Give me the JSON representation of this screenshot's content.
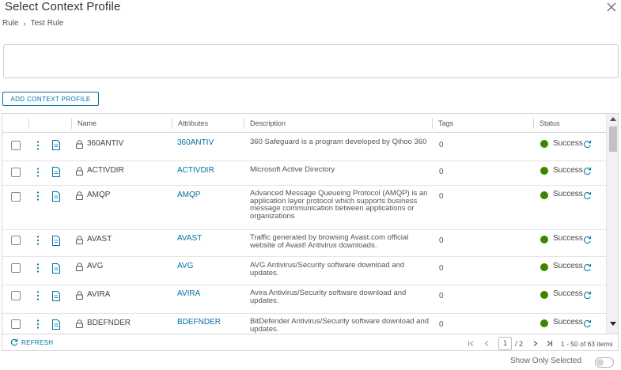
{
  "dialog": {
    "title": "Select Context Profile",
    "breadcrumb": [
      "Rule",
      "Test Rule"
    ]
  },
  "search": {
    "value": "",
    "placeholder": ""
  },
  "toolbar": {
    "add_label": "ADD CONTEXT PROFILE"
  },
  "grid": {
    "columns": [
      "Name",
      "Attributes",
      "Description",
      "Tags",
      "Status"
    ],
    "rows": [
      {
        "name": "360ANTIV",
        "attribute": "360ANTIV",
        "description": "360 Safeguard is a program developed by Qihoo 360",
        "tags": "0",
        "status": "Success"
      },
      {
        "name": "ACTIVDIR",
        "attribute": "ACTIVDIR",
        "description": "Microsoft Active Directory",
        "tags": "0",
        "status": "Success"
      },
      {
        "name": "AMQP",
        "attribute": "AMQP",
        "description": "Advanced Message Queueing Protocol (AMQP) is an application layer protocol which supports business message communication between applications or organizations",
        "tags": "0",
        "status": "Success"
      },
      {
        "name": "AVAST",
        "attribute": "AVAST",
        "description": "Traffic generated by browsing Avast.com official website of Avast! Antivirus downloads.",
        "tags": "0",
        "status": "Success"
      },
      {
        "name": "AVG",
        "attribute": "AVG",
        "description": "AVG Antivirus/Security software download and updates.",
        "tags": "0",
        "status": "Success"
      },
      {
        "name": "AVIRA",
        "attribute": "AVIRA",
        "description": "Avira Antivirus/Security software download and updates.",
        "tags": "0",
        "status": "Success"
      },
      {
        "name": "BDEFNDER",
        "attribute": "BDEFNDER",
        "description": "BitDefender Antivirus/Security software download and updates.",
        "tags": "0",
        "status": "Success"
      }
    ],
    "status_color": "#3c8500",
    "link_color": "#0072a3"
  },
  "footer": {
    "refresh_label": "REFRESH",
    "page_current": "1",
    "page_total": "/ 2",
    "range_text": "1 - 50 of 63 items"
  },
  "show_only_selected": {
    "label": "Show Only Selected",
    "enabled": false
  },
  "icons": {
    "close": "close-icon",
    "breadcrumb_separator": "chevron-right-icon",
    "row_menu": "kebab-menu-icon",
    "row_details": "document-icon",
    "locked": "lock-icon",
    "status_refresh": "refresh-icon"
  }
}
